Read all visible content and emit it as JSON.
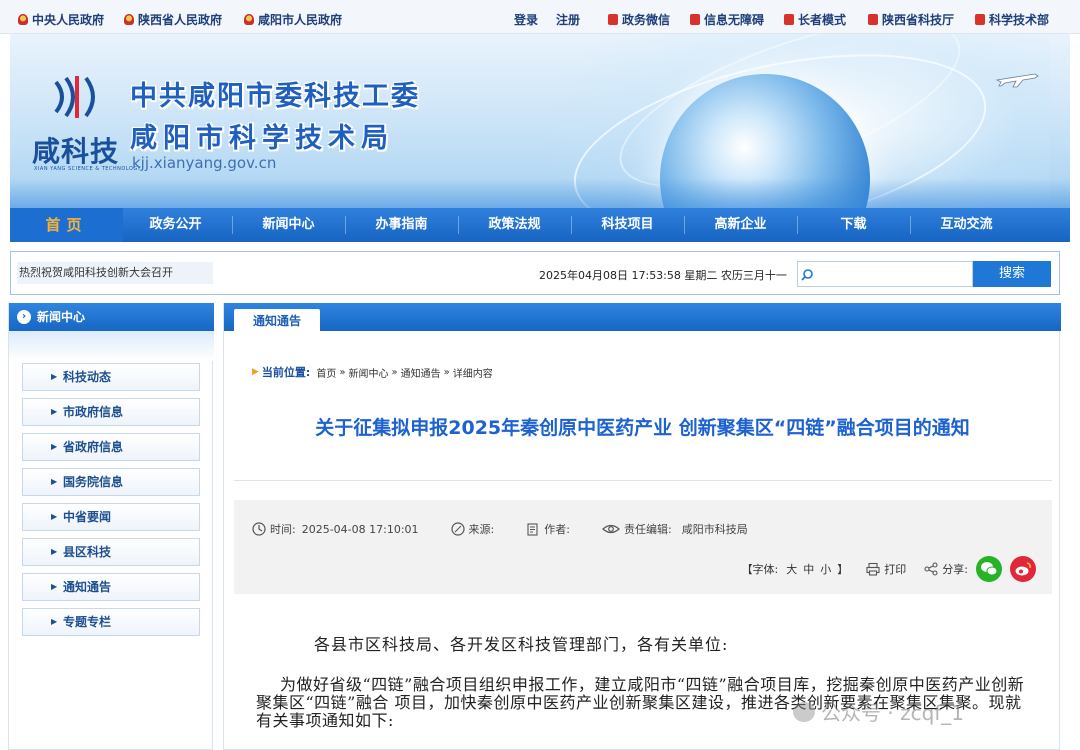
{
  "topbar": {
    "left_links": [
      "中央人民政府",
      "陕西省人民政府",
      "咸阳市人民政府"
    ],
    "login": "登录",
    "register": "注册",
    "right_links": [
      "政务微信",
      "信息无障碍",
      "长者模式",
      "陕西省科技厅",
      "科学技术部"
    ]
  },
  "banner": {
    "logo_cn": "咸科技",
    "logo_en": "XIAN YANG SCIENCE & TECHNOLOGY",
    "title_line1": "中共咸阳市委科技工委",
    "title_line2": "咸阳市科学技术局",
    "domain": "kjj.xianyang.gov.cn"
  },
  "nav": {
    "tabs": [
      "首页",
      "政务公开",
      "新闻中心",
      "办事指南",
      "政策法规",
      "科技项目",
      "高新企业",
      "下载",
      "互动交流"
    ],
    "active_index": 0
  },
  "infobar": {
    "ticker": "热烈祝贺咸阳科技创新大会召开",
    "datetime": "2025年04月08日 17:53:58 星期二 农历三月十一",
    "search_placeholder": "",
    "search_button": "搜索"
  },
  "sidebar": {
    "title": "新闻中心",
    "items": [
      "科技动态",
      "市政府信息",
      "省政府信息",
      "国务院信息",
      "中省要闻",
      "县区科技",
      "通知通告",
      "专题专栏"
    ]
  },
  "main": {
    "tab": "通知通告",
    "breadcrumb": {
      "label": "当前位置:",
      "path": [
        "首页",
        "新闻中心",
        "通知通告",
        "详细内容"
      ],
      "separator": "»"
    },
    "article_title": "关于征集拟申报2025年秦创原中医药产业 创新聚集区“四链”融合项目的通知",
    "meta": {
      "time_label": "时间:",
      "time_value": "2025-04-08 17:10:01",
      "source_label": "来源:",
      "author_label": "作者:",
      "editor_label": "责任编辑:",
      "editor_value": "咸阳市科技局",
      "font_label": "【字体:",
      "font_sizes": [
        "大",
        "中",
        "小"
      ],
      "font_close": "】",
      "print_label": "打印",
      "share_label": "分享:"
    },
    "body": {
      "salutation": "各县市区科技局、各开发区科技管理部门，各有关单位:",
      "paragraph1": "为做好省级“四链”融合项目组织申报工作，建立咸阳市“四链”融合项目库，挖掘秦创原中医药产业创新聚集区“四链”融合 项目，加快秦创原中医药产业创新聚集区建设，推进各类创新要素在聚集区集聚。现就有关事项通知如下:"
    }
  },
  "watermark": "公众号 · zcqf_1",
  "colors": {
    "nav_blue": "#1764c2",
    "title_blue": "#1d62d0",
    "active_tab_text": "#f7b23b",
    "wechat_green": "#27b227",
    "weibo_red": "#e0283a"
  }
}
